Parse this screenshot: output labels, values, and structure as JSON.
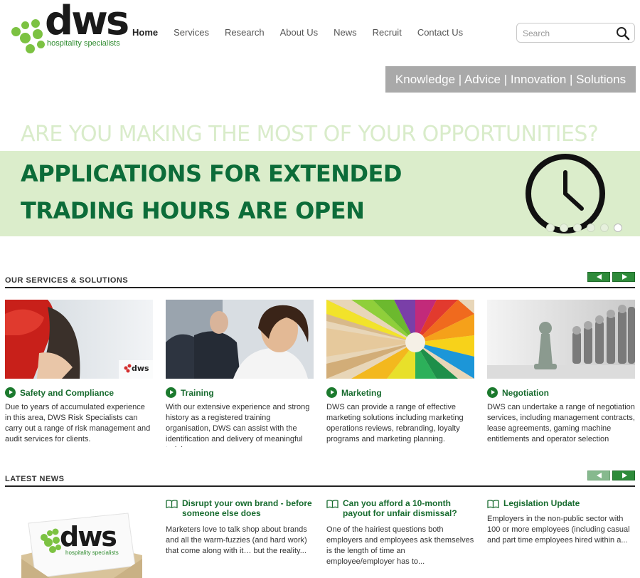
{
  "brand": {
    "name": "dws",
    "tagline": "hospitality specialists",
    "accent": "#7cc242",
    "dark_green": "#0c6c39"
  },
  "nav": [
    "Home",
    "Services",
    "Research",
    "About Us",
    "News",
    "Recruit",
    "Contact Us"
  ],
  "search": {
    "placeholder": "Search",
    "icon": "search-icon"
  },
  "tagline_bar": "Knowledge | Advice | Innovation | Solutions",
  "hero": {
    "question": "ARE YOU MAKING THE MOST OF YOUR OPPORTUNITIES?",
    "line1": "APPLICATIONS FOR EXTENDED",
    "line2": "TRADING HOURS ARE OPEN",
    "icon": "clock-icon",
    "slides": 6,
    "active_slide": 6
  },
  "services": {
    "heading": "OUR SERVICES & SOLUTIONS",
    "items": [
      {
        "title": "Safety and Compliance",
        "desc": "Due to years of accumulated experience in this area, DWS Risk Specialists can carry out a range of risk management and audit services for clients.",
        "image": "hard-hat-photo"
      },
      {
        "title": "Training",
        "desc": "With our extensive experience and strong history as a registered training organisation, DWS can assist with the identification and delivery of meaningful training",
        "image": "business-people-photo"
      },
      {
        "title": "Marketing",
        "desc": "DWS can provide a range of effective marketing solutions including marketing operations reviews, rebranding, loyalty programs and marketing planning.",
        "image": "colored-pencils-photo"
      },
      {
        "title": "Negotiation",
        "desc": "DWS can undertake a range of negotiation services, including management contracts, lease agreements, gaming machine entitlements and operator selection",
        "image": "chess-pieces-photo"
      }
    ]
  },
  "news": {
    "heading": "LATEST NEWS",
    "items": [
      {
        "title": "Disrupt your own brand - before someone else does",
        "desc": "Marketers love to talk shop about brands and all the warm-fuzzies (and hard work) that come along with it… but the reality..."
      },
      {
        "title": "Can you afford a 10-month payout for unfair dismissal?",
        "desc": "One of the hairiest questions both employers and employees ask themselves is the length of time an employee/employer has to..."
      },
      {
        "title": "Legislation Update",
        "desc": "Employers in the non-public sector with 100 or more employees (including casual and part time employees hired within a..."
      }
    ]
  }
}
